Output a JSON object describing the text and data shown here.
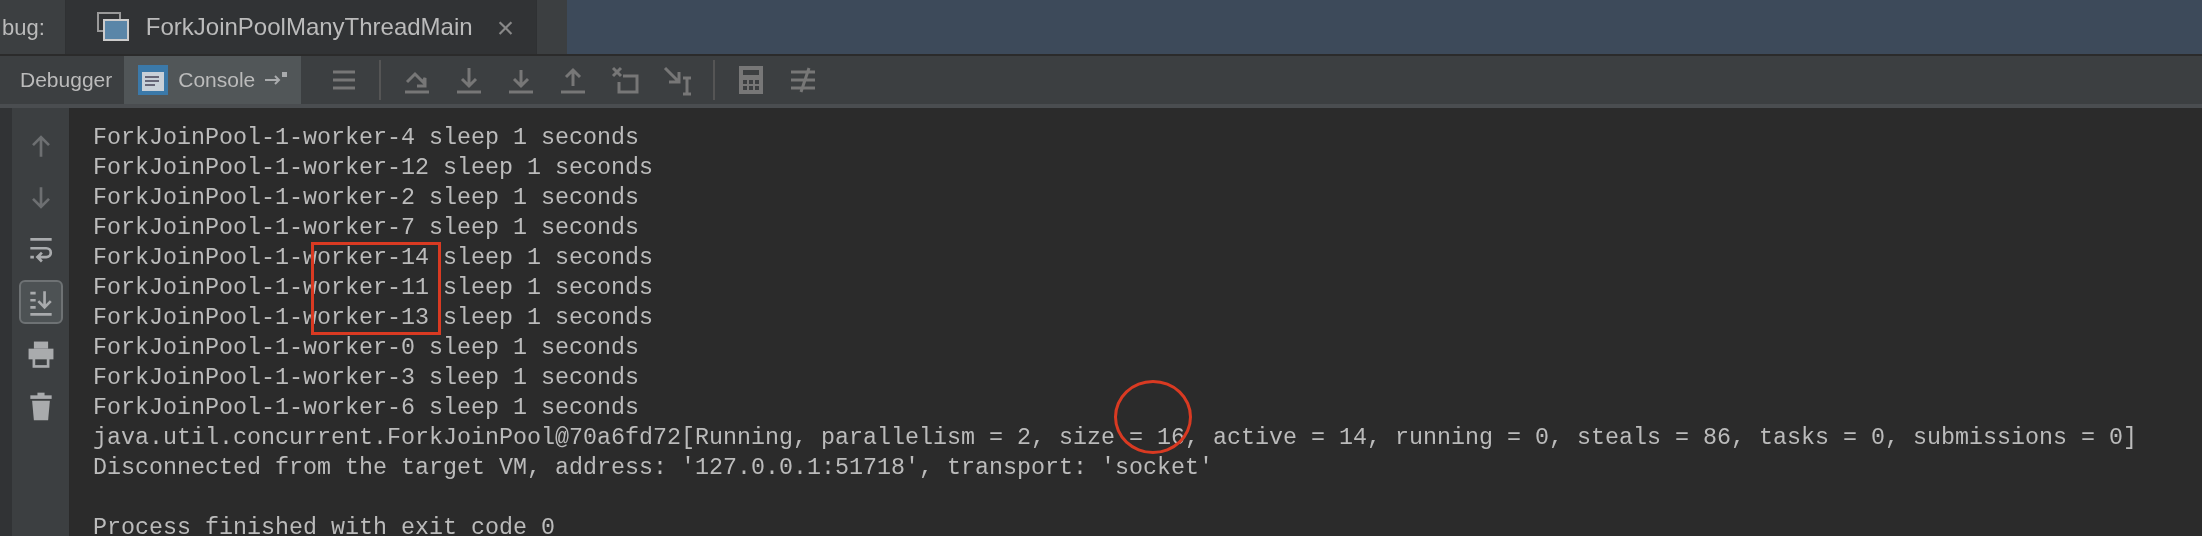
{
  "debug_label": "bug:",
  "run_tabs": [
    {
      "label": "ForkJoinPoolManyThreadMain",
      "selected": true,
      "close": "×"
    }
  ],
  "tool_tabs": [
    {
      "label": "Debugger",
      "selected": false,
      "kind": "debugger"
    },
    {
      "label": "Console",
      "selected": true,
      "kind": "console"
    }
  ],
  "toolbar_icons": [
    {
      "kind": "menu"
    },
    {
      "kind": "sep"
    },
    {
      "kind": "step-over"
    },
    {
      "kind": "step-into"
    },
    {
      "kind": "force-step-into"
    },
    {
      "kind": "step-out"
    },
    {
      "kind": "drop-frame"
    },
    {
      "kind": "run-to-cursor"
    },
    {
      "kind": "sep"
    },
    {
      "kind": "calculator"
    },
    {
      "kind": "trace"
    }
  ],
  "gutter_tools": [
    {
      "kind": "up",
      "selected": false,
      "disabled": true
    },
    {
      "kind": "down",
      "selected": false,
      "disabled": true
    },
    {
      "kind": "wrap",
      "selected": false,
      "disabled": false
    },
    {
      "kind": "scroll-end",
      "selected": true,
      "disabled": false
    },
    {
      "kind": "print",
      "selected": false,
      "disabled": false
    },
    {
      "kind": "trash",
      "selected": false,
      "disabled": false
    }
  ],
  "console": {
    "lines": [
      "ForkJoinPool-1-worker-4 sleep 1 seconds",
      "ForkJoinPool-1-worker-12 sleep 1 seconds",
      "ForkJoinPool-1-worker-2 sleep 1 seconds",
      "ForkJoinPool-1-worker-7 sleep 1 seconds",
      "ForkJoinPool-1-worker-14 sleep 1 seconds",
      "ForkJoinPool-1-worker-11 sleep 1 seconds",
      "ForkJoinPool-1-worker-13 sleep 1 seconds",
      "ForkJoinPool-1-worker-0 sleep 1 seconds",
      "ForkJoinPool-1-worker-3 sleep 1 seconds",
      "ForkJoinPool-1-worker-6 sleep 1 seconds",
      "java.util.concurrent.ForkJoinPool@70a6fd72[Running, parallelism = 2, size = 16, active = 14, running = 0, steals = 86, tasks = 0, submissions = 0]",
      "Disconnected from the target VM, address: '127.0.0.1:51718', transport: 'socket'"
    ],
    "closing_line": {
      "text": "Process finished with exit code 0",
      "gap_before": true
    },
    "annotations": [
      {
        "kind": "rectangle"
      },
      {
        "kind": "circle"
      }
    ]
  }
}
